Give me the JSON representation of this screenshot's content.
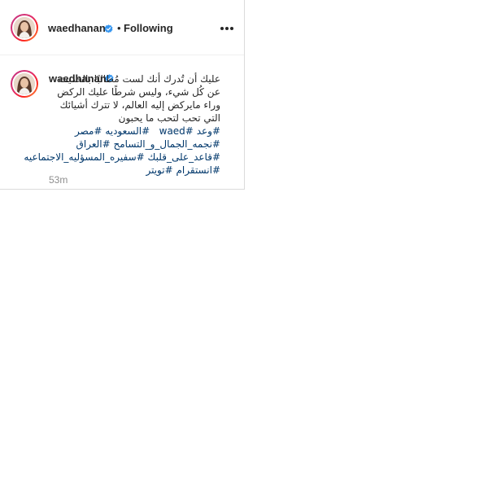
{
  "post": {
    "username": "waedhanan",
    "follow_status": "Following",
    "separator": "•",
    "verified_icon": "verified-badge-icon",
    "more_icon": "more-options-icon",
    "brand_color": "#c13584",
    "verified_color": "#3897f0",
    "hashtag_color": "#00376b"
  },
  "caption": {
    "username": "waedhanan",
    "text": "عليك أن تُدرك أنك لست مُطالبًا بالحديث عن كُل شيء، وليس شرطًا عليك الركض وراء مايركض إليه العالم، لا تترك أشيائك التي تحب لتحب ما يحبون",
    "hashtags": [
      "#وعد",
      "#waed",
      "#السعوديه",
      "#مصر",
      "#نجمه_الجمال_و_التسامح",
      "#العراق",
      "#قاعد_على_قلبك",
      "#سفيره_المسؤليه_الاجتماعيه",
      "#انستقرام",
      "#تويتر"
    ],
    "time_ago": "53m"
  }
}
